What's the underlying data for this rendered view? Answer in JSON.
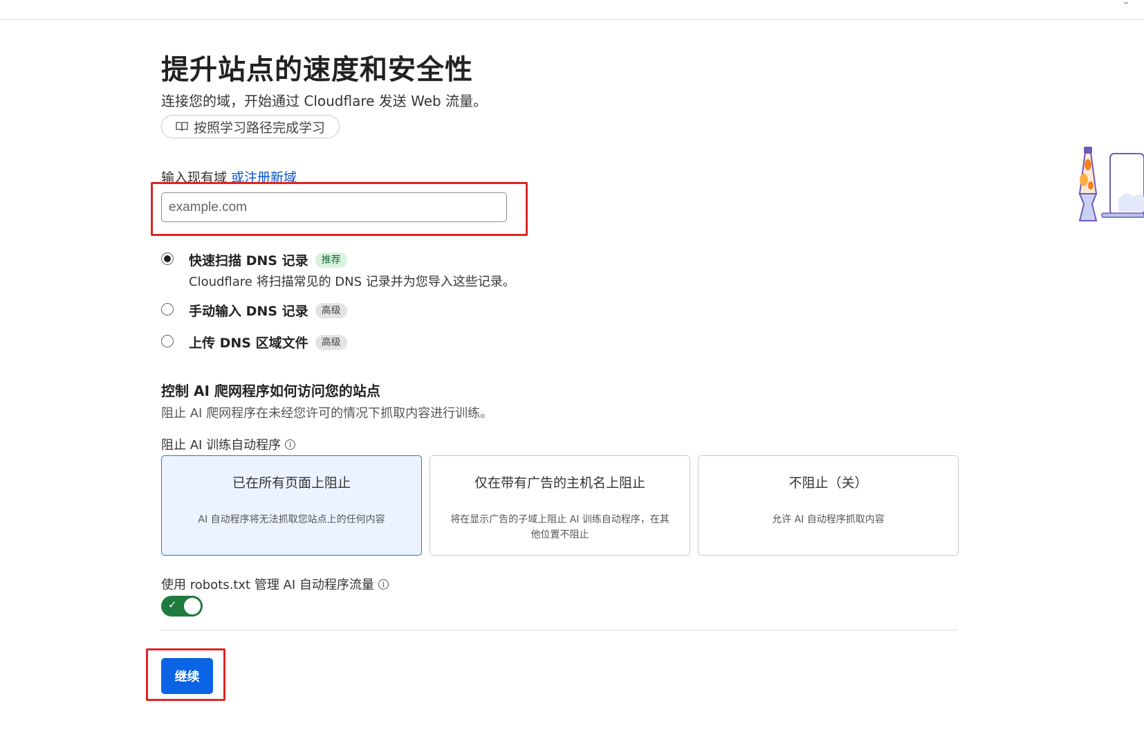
{
  "page": {
    "title": "提升站点的速度和安全性",
    "subtitle": "连接您的域，开始通过 Cloudflare 发送 Web 流量。",
    "learn_button": "按照学习路径完成学习"
  },
  "domain": {
    "label": "输入现有域",
    "register_link": "或注册新域",
    "placeholder": "example.com",
    "value": ""
  },
  "dns_options": [
    {
      "title": "快速扫描 DNS 记录",
      "tag": "推荐",
      "tag_style": "green",
      "desc": "Cloudflare 将扫描常见的 DNS 记录并为您导入这些记录。",
      "selected": true
    },
    {
      "title": "手动输入 DNS 记录",
      "tag": "高级",
      "tag_style": "gray",
      "desc": "",
      "selected": false
    },
    {
      "title": "上传 DNS 区域文件",
      "tag": "高级",
      "tag_style": "gray",
      "desc": "",
      "selected": false
    }
  ],
  "ai": {
    "section_title": "控制 AI 爬网程序如何访问您的站点",
    "section_desc": "阻止 AI 爬网程序在未经您许可的情况下抓取内容进行训练。",
    "block_label": "阻止 AI 训练自动程序",
    "info_glyph": "i",
    "cards": [
      {
        "title": "已在所有页面上阻止",
        "desc": "AI 自动程序将无法抓取您站点上的任何内容",
        "selected": true
      },
      {
        "title": "仅在带有广告的主机名上阻止",
        "desc": "将在显示广告的子域上阻止 AI 训练自动程序，在其他位置不阻止",
        "selected": false
      },
      {
        "title": "不阻止（关）",
        "desc": "允许 AI 自动程序抓取内容",
        "selected": false
      }
    ],
    "robots_label": "使用 robots.txt 管理 AI 自动程序流量",
    "robots_enabled": true,
    "toggle_check": "✓"
  },
  "actions": {
    "continue_label": "继续"
  },
  "colors": {
    "accent": "#0b63e5",
    "highlight": "#e02424",
    "toggle_on": "#1f7a3e",
    "selected_card_bg": "#eaf3ff"
  }
}
